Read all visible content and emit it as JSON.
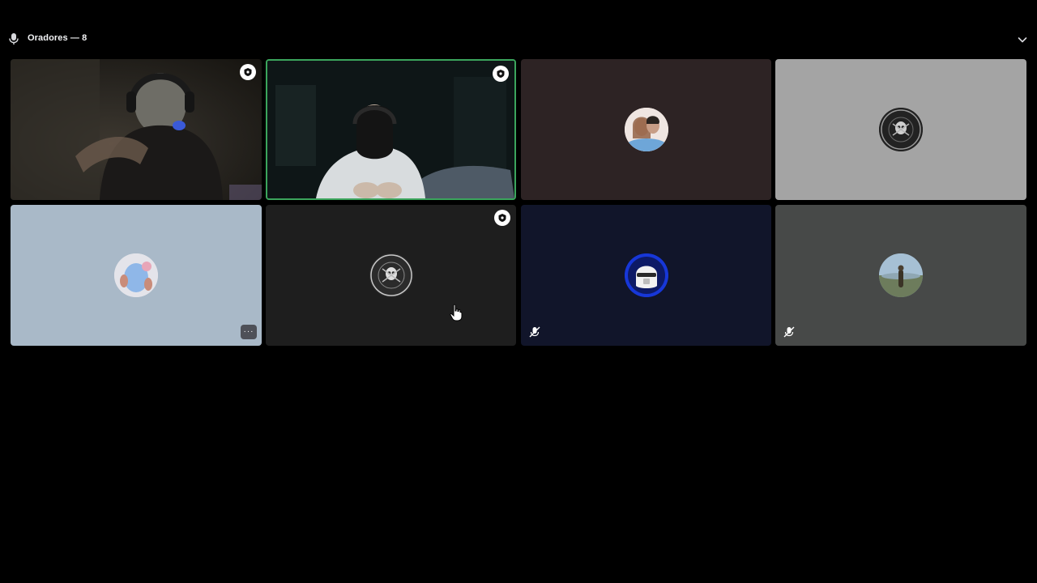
{
  "stage": {
    "title": "Oradores — 8"
  },
  "colors": {
    "speaking_border": "#3ba55c",
    "tile_dark_brown": "#2d2324",
    "tile_light_gray": "#a4a4a4",
    "tile_light_blue": "#a9b9c8",
    "tile_charcoal": "#1e1e1e",
    "tile_navy": "#11152a",
    "tile_slate": "#474948"
  },
  "icons": {
    "header_mic": "microphone-icon",
    "collapse": "chevron-down-icon",
    "badge": "moderator-badge-icon",
    "muted": "muted-microphone-icon",
    "more": "more-options-icon"
  },
  "more_label": "···"
}
